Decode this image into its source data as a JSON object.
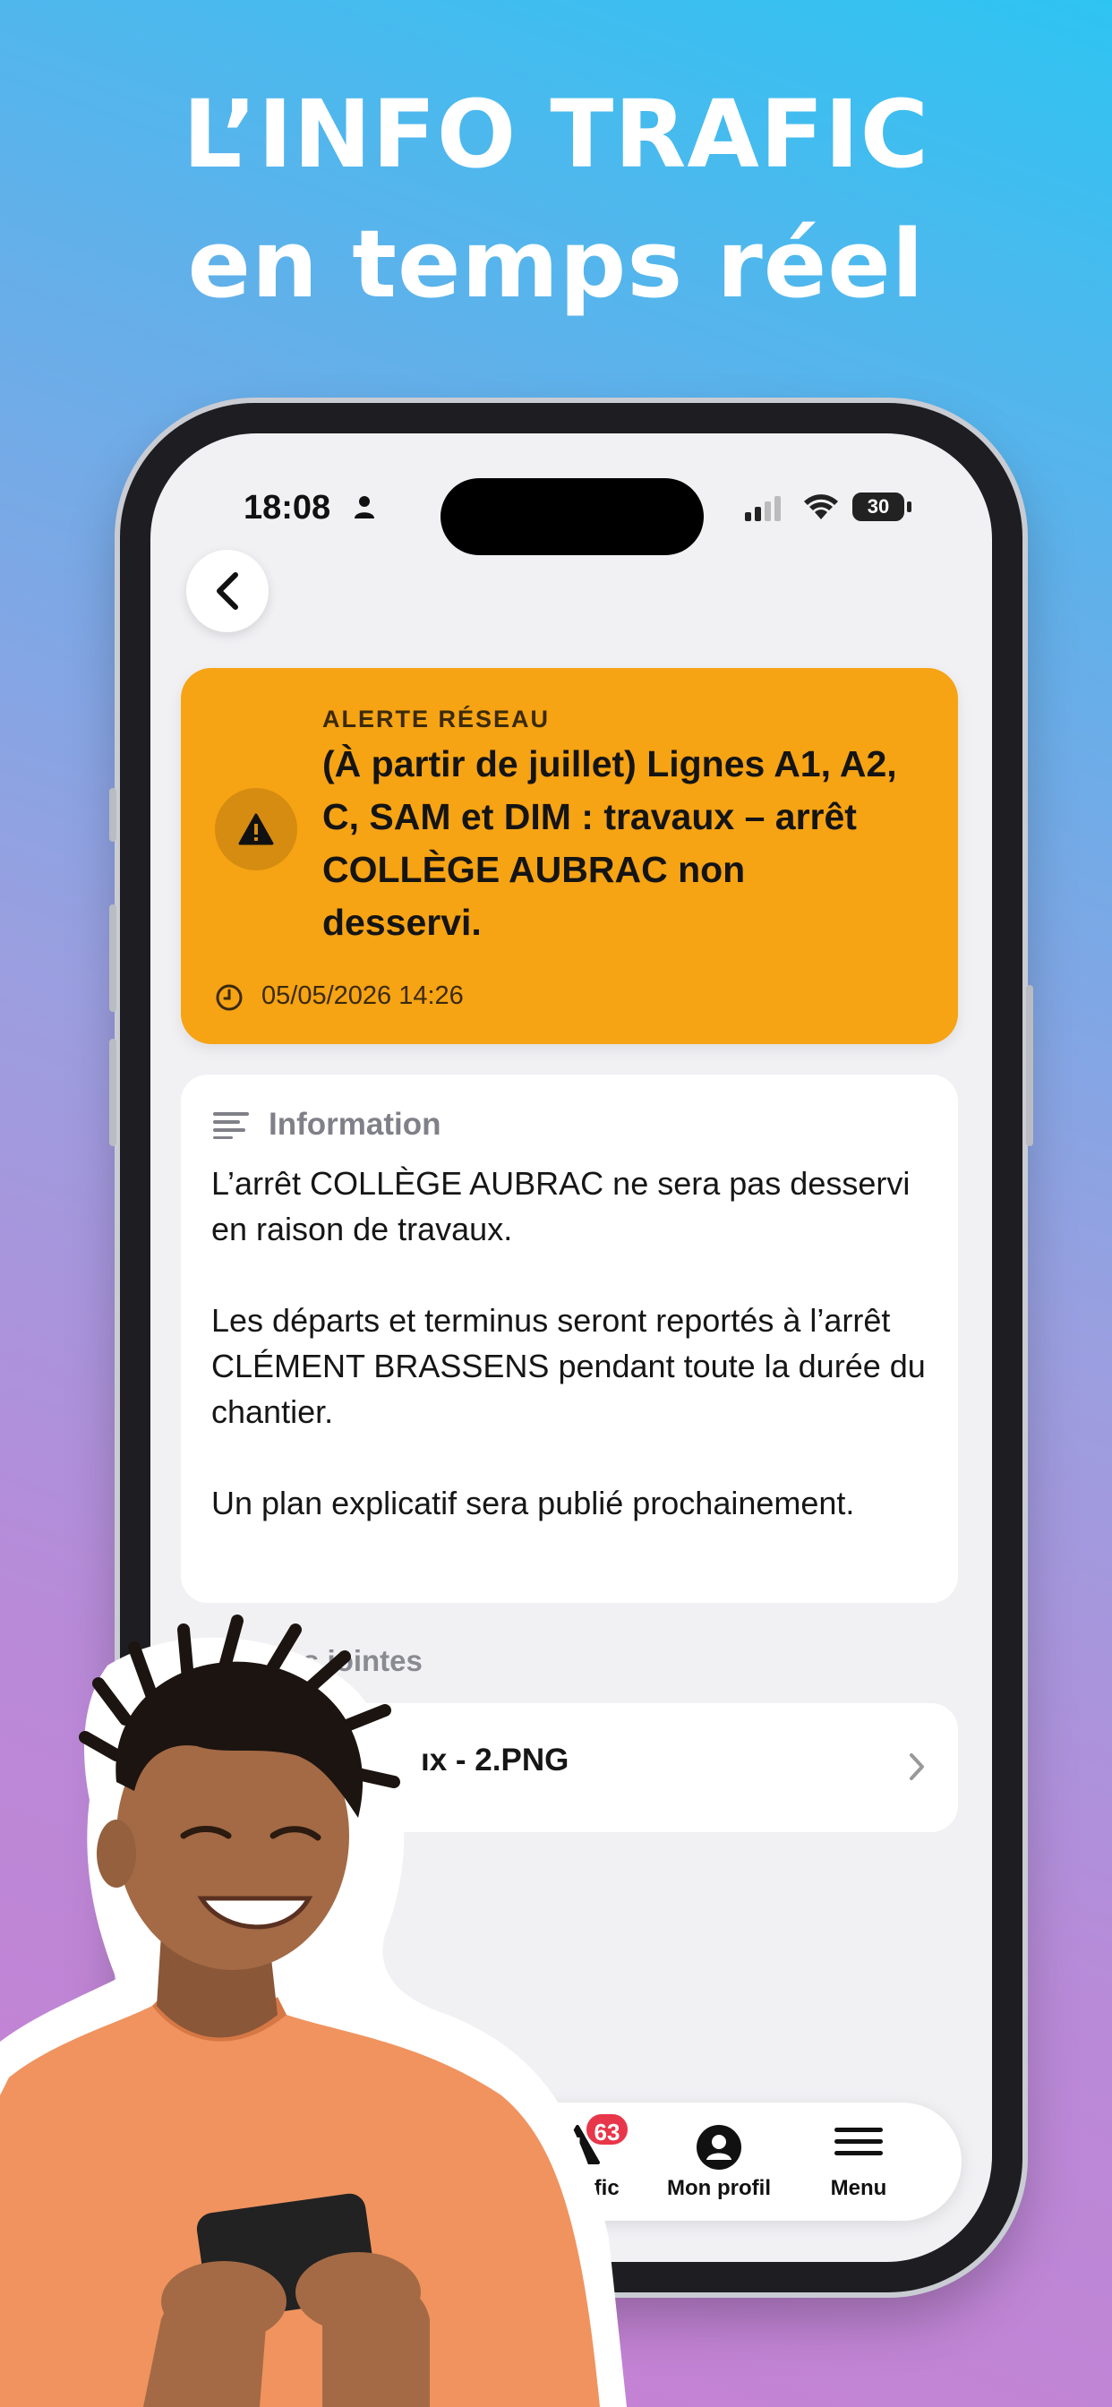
{
  "headline": {
    "line1": "L’INFO TRAFIC",
    "line2": "en temps réel"
  },
  "status_bar": {
    "time": "18:08",
    "battery": "30"
  },
  "alert": {
    "kicker": "ALERTE RÉSEAU",
    "title": "(À partir de juillet) Lignes A1, A2, C, SAM et DIM : travaux – arrêt COLLÈGE AUBRAC non desservi.",
    "timestamp": "05/05/2026 14:26",
    "color": "#f6a314"
  },
  "info": {
    "heading": "Information",
    "paragraphs": [
      "L’arrêt COLLÈGE AUBRAC ne sera pas desservi en raison de travaux.",
      "Les départs et terminus seront reportés à l’arrêt CLÉMENT BRASSENS pendant toute la durée du chantier.",
      "Un plan explicatif sera publié prochainement."
    ]
  },
  "attachments": {
    "heading": "s jointes",
    "items": [
      {
        "name": "ıx - 2.PNG"
      }
    ]
  },
  "tabbar": {
    "items": [
      {
        "label": "fo Trafic",
        "icon": "warning-icon",
        "badge": "63"
      },
      {
        "label": "Mon profil",
        "icon": "profile-icon"
      },
      {
        "label": "Menu",
        "icon": "menu-icon"
      }
    ]
  },
  "colors": {
    "badge": "#e8364a",
    "background_top": "#2ec4f2",
    "background_bottom": "#c97fd2"
  }
}
